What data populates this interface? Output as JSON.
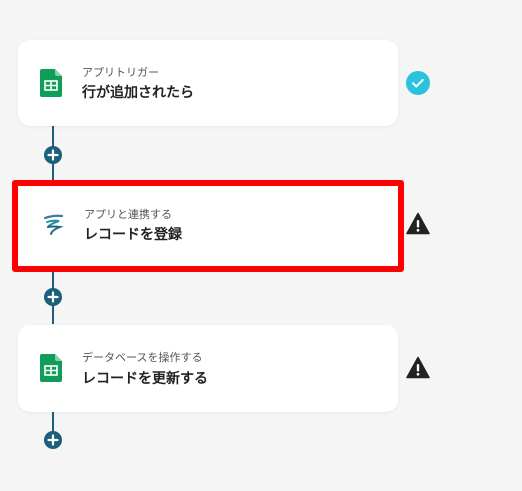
{
  "steps": [
    {
      "subtitle": "アプリトリガー",
      "title": "行が追加されたら",
      "icon": "google-sheets-icon",
      "status": "check-circle-icon"
    },
    {
      "subtitle": "アプリと連携する",
      "title": "レコードを登録",
      "icon": "app-logo-icon",
      "status": "warning-icon"
    },
    {
      "subtitle": "データベースを操作する",
      "title": "レコードを更新する",
      "icon": "google-sheets-icon",
      "status": "warning-icon"
    }
  ],
  "add_step_icon": "plus-icon",
  "colors": {
    "accent": "#1b5f7a",
    "success": "#2bc3dc",
    "highlight": "#ff0000",
    "sheets_green": "#0f9d58"
  }
}
